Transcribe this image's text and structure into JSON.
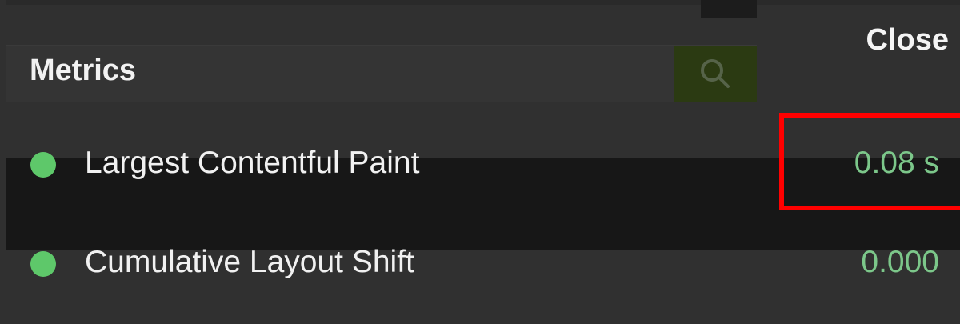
{
  "panel": {
    "title": "Metrics",
    "close_label": "Close",
    "search_icon": "search-icon"
  },
  "metrics": [
    {
      "label": "Largest Contentful Paint",
      "value": "0.08 s",
      "status": "good",
      "status_color": "#5ec86a"
    },
    {
      "label": "Cumulative Layout Shift",
      "value": "0.000",
      "status": "good",
      "status_color": "#5ec86a"
    }
  ],
  "annotation": {
    "highlight_color": "#ff0000",
    "highlighted_metric": "Largest Contentful Paint"
  }
}
